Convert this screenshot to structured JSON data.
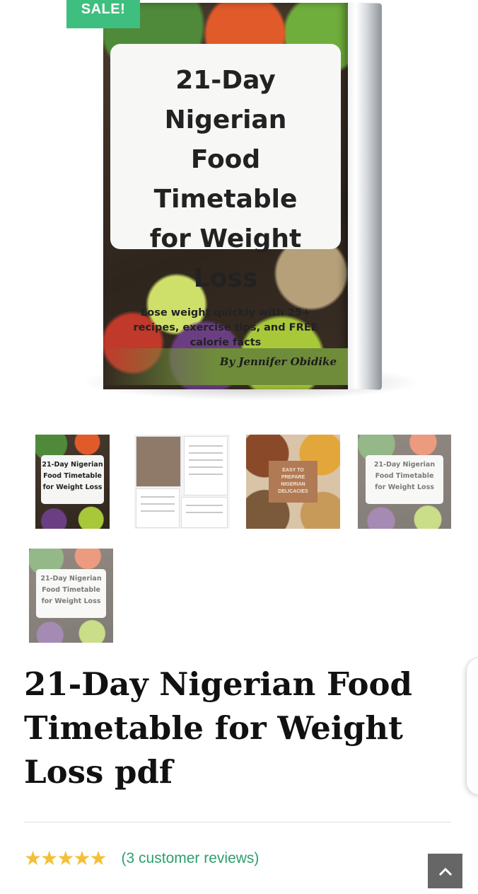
{
  "badge": {
    "sale": "SALE!"
  },
  "cover": {
    "title_lines": [
      "21-Day Nigerian",
      "Food Timetable",
      "for Weight Loss"
    ],
    "subtitle": "Lose weight quickly with 25+ recipes, exercise tips, and FREE calorie facts",
    "author": "By Jennifer Obidike"
  },
  "thumbnails": [
    {
      "type": "cover",
      "lines": [
        "21-Day Nigerian",
        "Food Timetable",
        "for Weight Loss"
      ]
    },
    {
      "type": "pages"
    },
    {
      "type": "recipe",
      "label": "EASY TO PREPARE NIGERIAN DELICACIES"
    },
    {
      "type": "cover-faded",
      "lines": [
        "21-Day Nigerian",
        "Food Timetable",
        "for Weight Loss"
      ]
    },
    {
      "type": "cover-faded",
      "lines": [
        "21-Day Nigerian",
        "Food Timetable",
        "for Weight Loss"
      ]
    }
  ],
  "product": {
    "title": "21-Day Nigerian Food Timetable for Weight Loss pdf",
    "rating": {
      "stars": 5,
      "max": 5,
      "reviews_text": "(3 customer reviews)"
    }
  },
  "colors": {
    "sale_badge": "#3fbf7f",
    "star": "#f5bf36",
    "link": "#2f9e6f",
    "scroll_button": "#666666"
  },
  "icons": {
    "scroll_top": "chevron-up-icon",
    "star": "star-icon"
  }
}
